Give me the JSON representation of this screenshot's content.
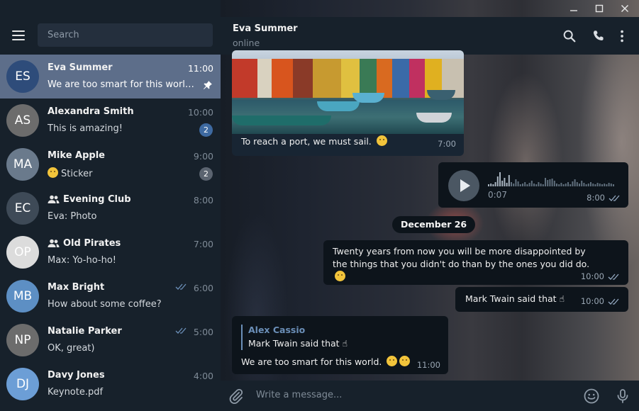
{
  "window": {
    "controls": [
      "minimize",
      "maximize",
      "close"
    ]
  },
  "sidebar": {
    "search_placeholder": "Search",
    "chats": [
      {
        "initials": "ES",
        "color": "#2e4c7a",
        "name": "Eva Summer",
        "time": "11:00",
        "preview": "We are too smart for this world. 🤣😂",
        "pinned": true,
        "active": true
      },
      {
        "initials": "AS",
        "color": "#6c6c6c",
        "name": "Alexandra Smith",
        "time": "10:00",
        "preview": "This is amazing!",
        "badge": "2"
      },
      {
        "initials": "MA",
        "color": "#6a7a8c",
        "name": "Mike Apple",
        "time": "9:00",
        "preview": "Sticker",
        "preview_emoji": "😄",
        "badge": "2",
        "badge_muted": true
      },
      {
        "initials": "EC",
        "color": "#3e4a57",
        "name": "Evening Club",
        "time": "8:00",
        "preview": "Eva: Photo",
        "group": true
      },
      {
        "initials": "OP",
        "color": "#dcdcdc",
        "name": "Old Pirates",
        "time": "7:00",
        "preview": "Max: Yo-ho-ho!",
        "group": true
      },
      {
        "initials": "MB",
        "color": "#5d8fc4",
        "name": "Max Bright",
        "time": "6:00",
        "preview": "How about some coffee?",
        "read": true
      },
      {
        "initials": "NP",
        "color": "#6c6c6c",
        "name": "Natalie Parker",
        "time": "5:00",
        "preview": "OK, great)",
        "read": true
      },
      {
        "initials": "DJ",
        "color": "#6c9ed6",
        "name": "Davy Jones",
        "time": "4:00",
        "preview": "Keynote.pdf"
      }
    ]
  },
  "chat": {
    "peer_name": "Eva Summer",
    "peer_status": "online",
    "photo_caption": "To reach a port, we must sail.",
    "photo_time": "7:00",
    "voice_duration": "0:07",
    "voice_time": "8:00",
    "date_separator": "December 26",
    "msg_twenty": "Twenty years from now you will be more disappointed by the things that you didn't do than by the ones you did do.",
    "msg_twenty_time": "10:00",
    "msg_mark": "Mark Twain said that",
    "msg_mark_time": "10:00",
    "reply_author": "Alex Cassio",
    "reply_text": "Mark Twain said that",
    "reply_body": "We are too smart for this world.",
    "reply_time": "11:00"
  },
  "composer": {
    "placeholder": "Write a message..."
  }
}
